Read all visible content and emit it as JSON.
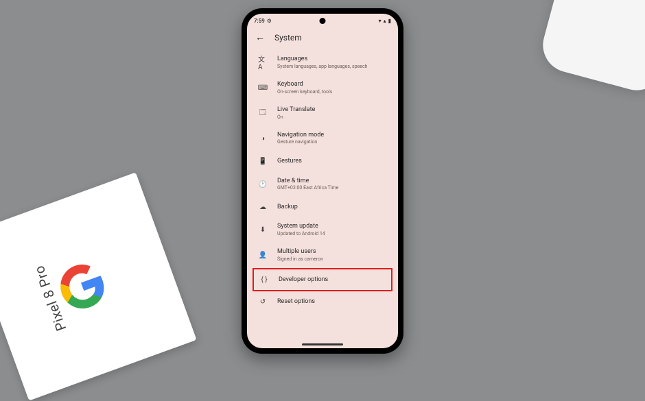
{
  "status": {
    "time": "7:59",
    "settings_icon": "⚙",
    "wifi_icon": "▾",
    "signal_icon": "▴",
    "battery_icon": "▮"
  },
  "header": {
    "title": "System"
  },
  "items": [
    {
      "icon": "文A",
      "title": "Languages",
      "sub": "System languages, app languages, speech"
    },
    {
      "icon": "⌨",
      "title": "Keyboard",
      "sub": "On-screen keyboard, tools"
    },
    {
      "icon": "🗔",
      "title": "Live Translate",
      "sub": "On"
    },
    {
      "icon": "◑",
      "title": "Navigation mode",
      "sub": "Gesture navigation"
    },
    {
      "icon": "📱",
      "title": "Gestures",
      "sub": ""
    },
    {
      "icon": "🕐",
      "title": "Date & time",
      "sub": "GMT+03:00 East Africa Time"
    },
    {
      "icon": "☁",
      "title": "Backup",
      "sub": ""
    },
    {
      "icon": "⬇",
      "title": "System update",
      "sub": "Updated to Android 14"
    },
    {
      "icon": "👤",
      "title": "Multiple users",
      "sub": "Signed in as cameron"
    },
    {
      "icon": "{ }",
      "title": "Developer options",
      "sub": ""
    },
    {
      "icon": "↺",
      "title": "Reset options",
      "sub": ""
    }
  ],
  "box_label": "Pixel 8 Pro"
}
